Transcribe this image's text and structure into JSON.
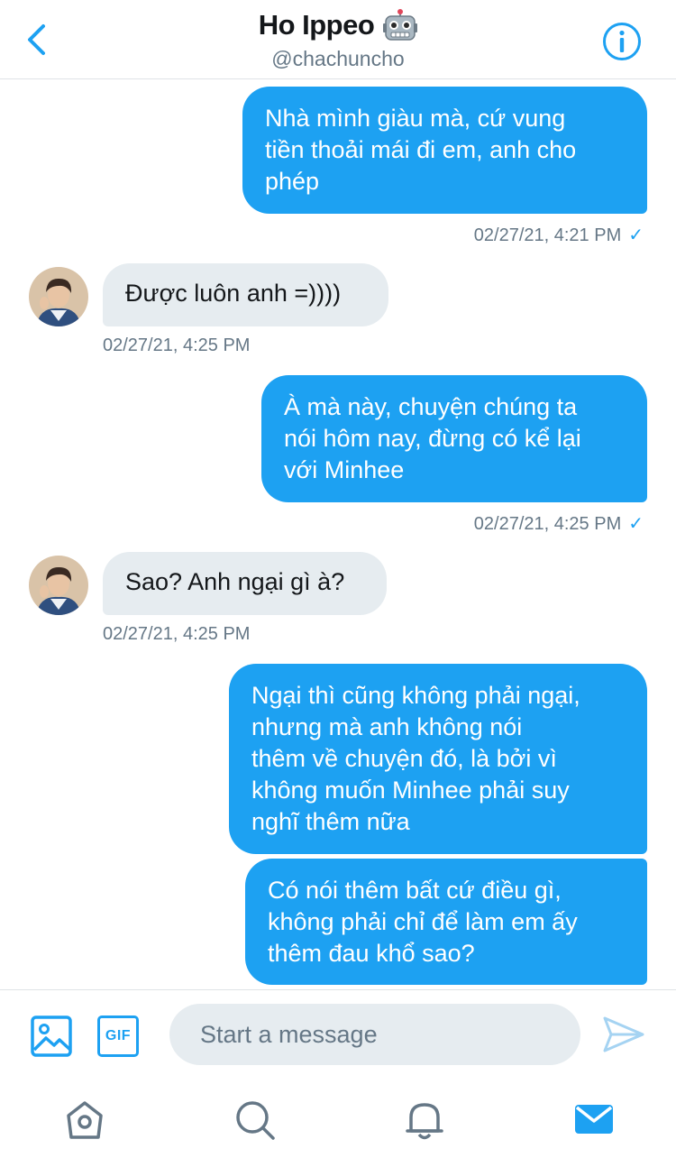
{
  "header": {
    "name": "Ho Ippeo",
    "emoji_icon": "robot-face-icon",
    "handle": "@chachuncho",
    "back_icon": "chevron-left-icon",
    "info_icon": "info-circle-icon"
  },
  "messages": [
    {
      "direction": "sent",
      "lines": [
        "Nhà mình giàu mà, cứ vung",
        "tiền thoải mái đi em, anh cho",
        "phép"
      ],
      "timestamp": "02/27/21, 4:21 PM",
      "status_icon": "checkmark-icon"
    },
    {
      "direction": "received",
      "lines": [
        "Được luôn anh =))))"
      ],
      "timestamp": "02/27/21, 4:25 PM"
    },
    {
      "direction": "sent",
      "lines": [
        "À mà này, chuyện chúng ta",
        "nói hôm nay, đừng có kể lại",
        "với Minhee"
      ],
      "timestamp": "02/27/21, 4:25 PM",
      "status_icon": "checkmark-icon"
    },
    {
      "direction": "received",
      "lines": [
        "Sao? Anh ngại gì à?"
      ],
      "timestamp": "02/27/21, 4:25 PM"
    },
    {
      "direction": "sent",
      "lines": [
        "Ngại thì cũng không phải ngại,",
        "nhưng mà anh không nói",
        "thêm về chuyện đó, là bởi vì",
        "không muốn Minhee phải suy",
        "nghĩ thêm nữa"
      ]
    },
    {
      "direction": "sent",
      "lines": [
        "Có nói thêm bất cứ điều gì,",
        "không phải chỉ để làm em ấy",
        "thêm đau khổ sao?"
      ]
    }
  ],
  "check_mark": "✓",
  "composer": {
    "placeholder": "Start a message",
    "value": "",
    "image_icon": "image-icon",
    "gif_label": "GIF",
    "send_icon": "send-icon"
  },
  "tabbar": {
    "items": [
      "home-icon",
      "search-icon",
      "bell-icon",
      "mail-icon"
    ],
    "active": "mail-icon"
  },
  "colors": {
    "accent": "#1da1f2",
    "received_bubble": "#e6ecf0",
    "secondary_text": "#657786",
    "icon_gray": "#657786"
  }
}
